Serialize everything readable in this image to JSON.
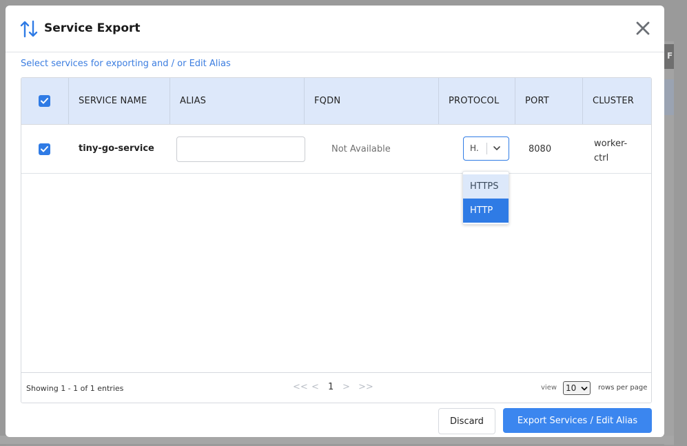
{
  "underlay": {
    "tab_letter": "F"
  },
  "modal": {
    "title": "Service Export",
    "header_icon": "swap-vertical-icon",
    "close_icon": "close-icon",
    "subtitle": "Select services for exporting and / or Edit Alias"
  },
  "table": {
    "columns": [
      "SERVICE NAME",
      "ALIAS",
      "FQDN",
      "PROTOCOL",
      "PORT",
      "CLUSTER"
    ],
    "select_all_checked": true,
    "rows": [
      {
        "checked": true,
        "service_name": "tiny-go-service",
        "alias_value": "",
        "fqdn": "Not Available",
        "protocol_display": "H.",
        "port": "8080",
        "cluster_line1": "worker-",
        "cluster_line2": "ctrl"
      }
    ],
    "protocol_options": [
      "HTTPS",
      "HTTP"
    ],
    "protocol_selected": "HTTP"
  },
  "footer": {
    "showing": "Showing 1 - 1 of 1 entries",
    "pager": {
      "first": "<<",
      "prev": "<",
      "current": "1",
      "next": ">",
      "last": ">>"
    },
    "view_label": "view",
    "rows_per_page_value": "10",
    "rows_per_page_label": "rows per page"
  },
  "actions": {
    "discard": "Discard",
    "export": "Export Services / Edit Alias"
  },
  "colors": {
    "accent": "#2f7be5",
    "header_bg": "#dde8fa",
    "link": "#3b7de0"
  }
}
